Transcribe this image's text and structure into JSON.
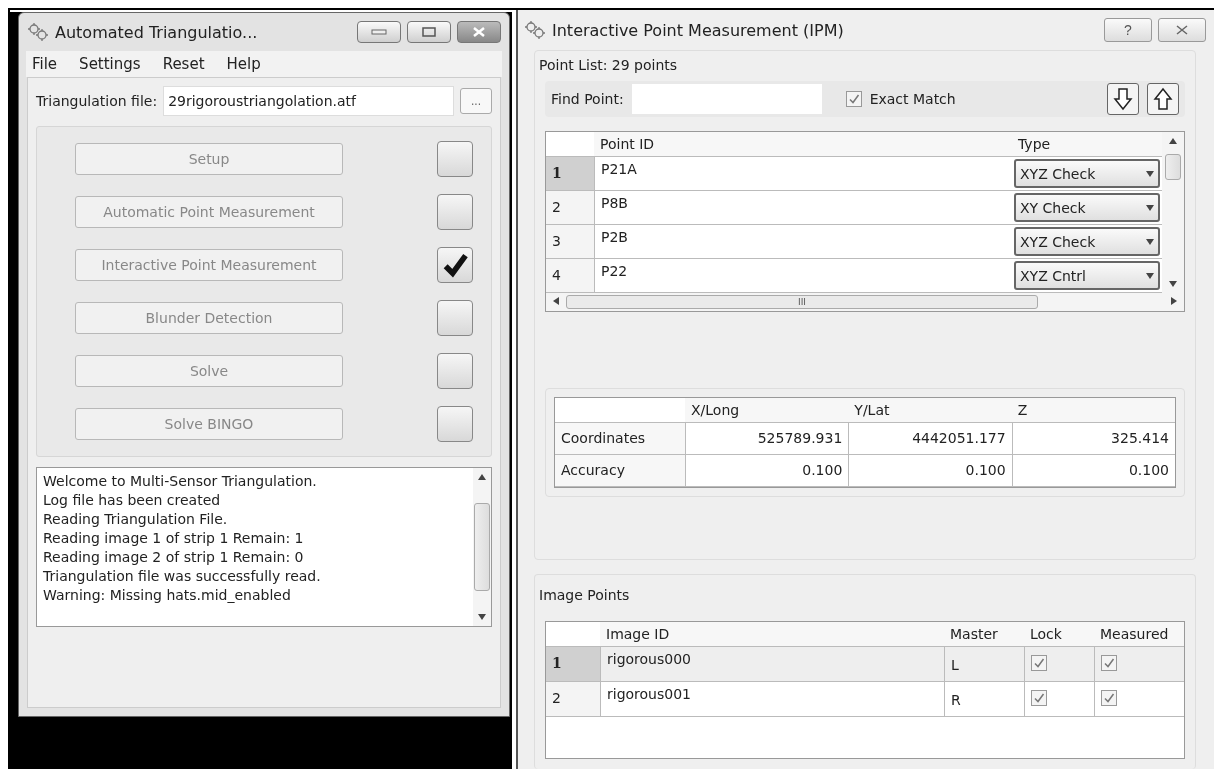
{
  "triangulation_window": {
    "title": "Automated Triangulatio...",
    "menu": [
      "File",
      "Settings",
      "Reset",
      "Help"
    ],
    "file_label": "Triangulation file:",
    "file_value": "29rigoroustriangolation.atf",
    "browse_button": "...",
    "steps": [
      {
        "label": "Setup",
        "done": false
      },
      {
        "label": "Automatic Point Measurement",
        "done": false
      },
      {
        "label": "Interactive Point Measurement",
        "done": true
      },
      {
        "label": "Blunder Detection",
        "done": false
      },
      {
        "label": "Solve",
        "done": false
      },
      {
        "label": "Solve BINGO",
        "done": false
      }
    ],
    "log": [
      "Welcome to Multi-Sensor Triangulation.",
      "Log file has been created",
      "Reading Triangulation File.",
      "Reading image 1 of strip 1  Remain: 1",
      "Reading image 2 of strip 1  Remain: 0",
      "Triangulation file was successfully read.",
      "Warning: Missing hats.mid_enabled"
    ]
  },
  "ipm_window": {
    "title": "Interactive Point Measurement (IPM)",
    "help_button": "?",
    "point_list": {
      "title": "Point List: 29 points",
      "find_label": "Find Point:",
      "exact_match": {
        "label": "Exact Match",
        "checked": true
      },
      "columns": [
        "Point ID",
        "Type"
      ],
      "rows": [
        {
          "number": "1",
          "id": "P21A",
          "type": "XYZ Check",
          "selected": true
        },
        {
          "number": "2",
          "id": "P8B",
          "type": "XY Check",
          "selected": false
        },
        {
          "number": "3",
          "id": "P2B",
          "type": "XYZ Check",
          "selected": false
        },
        {
          "number": "4",
          "id": "P22",
          "type": "XYZ Cntrl",
          "selected": false
        }
      ],
      "scroll_mark": "III"
    },
    "coordinates": {
      "columns": [
        "X/Long",
        "Y/Lat",
        "Z"
      ],
      "rows": [
        {
          "label": "Coordinates",
          "values": [
            "525789.931",
            "4442051.177",
            "325.414"
          ]
        },
        {
          "label": "Accuracy",
          "values": [
            "0.100",
            "0.100",
            "0.100"
          ]
        }
      ]
    },
    "image_points": {
      "title": "Image Points",
      "columns": [
        "Image ID",
        "Master",
        "Lock",
        "Measured"
      ],
      "rows": [
        {
          "number": "1",
          "id": "rigorous000",
          "master": "L",
          "lock": true,
          "measured": true,
          "selected": true
        },
        {
          "number": "2",
          "id": "rigorous001",
          "master": "R",
          "lock": true,
          "measured": true,
          "selected": false
        }
      ]
    }
  }
}
